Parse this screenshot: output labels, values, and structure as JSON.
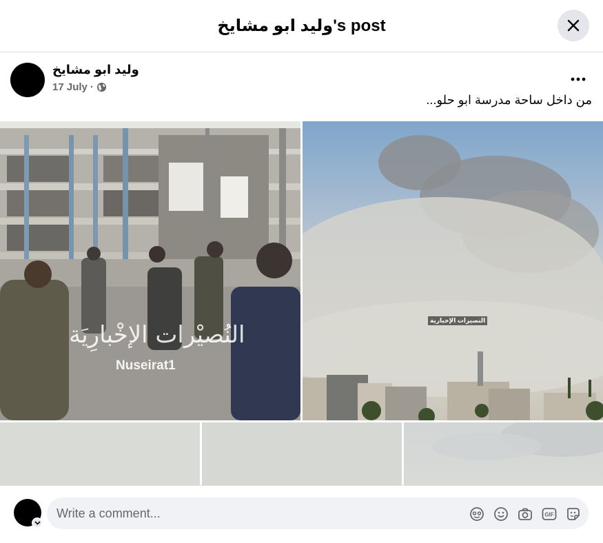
{
  "header": {
    "title": "وليد ابو مشايخ's post"
  },
  "post": {
    "author": "وليد ابو مشايخ",
    "date": "17 July",
    "separator": "·",
    "caption": "من داخل ساحة مدرسة ابو حلو..."
  },
  "photos": [
    {
      "watermark_ar": "النُصيْرات الإخْبارِيَة",
      "watermark_en": "Nuseirat1"
    },
    {
      "watermark_small": "النصيرات الإخبارية"
    }
  ],
  "comment": {
    "placeholder": "Write a comment...",
    "gif_label": "GIF"
  },
  "icons": [
    "close-icon",
    "more-icon",
    "globe-icon",
    "avatar-chevron-icon",
    "sticker-face-icon",
    "emoji-icon",
    "camera-icon",
    "gif-icon",
    "sticker-icon"
  ],
  "colors": {
    "background": "#ffffff",
    "secondary_text": "#65676b",
    "button_bg": "#e4e6eb",
    "input_bg": "#f0f2f5"
  }
}
